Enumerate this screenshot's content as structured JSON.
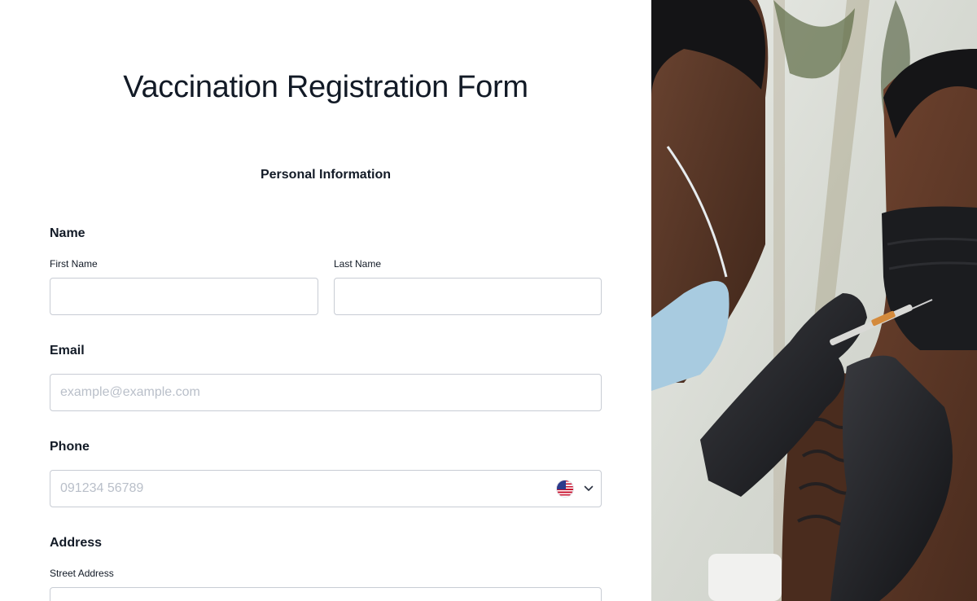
{
  "form": {
    "title": "Vaccination Registration Form",
    "section_title": "Personal Information",
    "name": {
      "label": "Name",
      "first_label": "First Name",
      "first_value": "",
      "last_label": "Last Name",
      "last_value": ""
    },
    "email": {
      "label": "Email",
      "value": "",
      "placeholder": "example@example.com"
    },
    "phone": {
      "label": "Phone",
      "value": "",
      "placeholder": "091234 56789",
      "country_icon": "us-flag-icon"
    },
    "address": {
      "label": "Address",
      "street_label": "Street Address",
      "street_value": ""
    }
  },
  "photo": {
    "subject": "vaccination-photo"
  },
  "colors": {
    "border": "#c8ccd4",
    "text": "#121a26",
    "placeholder": "#b9bfc9",
    "glove": "#1b1c1f",
    "mask_blue": "#9ec4dc"
  }
}
